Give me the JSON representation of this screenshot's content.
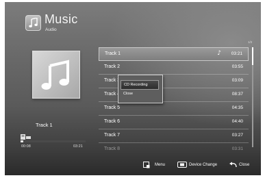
{
  "header": {
    "title": "Music",
    "subtitle": "Audio",
    "icon": "music-folder-icon"
  },
  "album_art": {
    "icon": "music-note-icon"
  },
  "player": {
    "now_playing": "Track 1",
    "mode_icon": "repeat-mode-icon",
    "time_start": "00:08",
    "time_end": "03:21",
    "progress": 0.04
  },
  "tracklist": {
    "page_indicator": "1/2",
    "scroll_position": 0.0,
    "tracks": [
      {
        "name": "Track 1",
        "duration": "03:21",
        "playing": true
      },
      {
        "name": "Track 2",
        "duration": "03:55"
      },
      {
        "name": "Track 3",
        "duration": "03:09"
      },
      {
        "name": "Track 4",
        "duration": "08:37"
      },
      {
        "name": "Track 5",
        "duration": "04:35"
      },
      {
        "name": "Track 6",
        "duration": "04:40"
      },
      {
        "name": "Track 7",
        "duration": "03:27"
      },
      {
        "name": "Track 8",
        "duration": "03:31"
      }
    ]
  },
  "context_menu": {
    "items": [
      {
        "label": "CD Recording",
        "active": true
      },
      {
        "label": "Close",
        "active": false
      }
    ]
  },
  "footer": {
    "menu_label": "Menu",
    "device_change_label": "Device Change",
    "close_label": "Close"
  },
  "colors": {
    "selection": "#8c8c8c",
    "background": "#5a5a5a"
  }
}
